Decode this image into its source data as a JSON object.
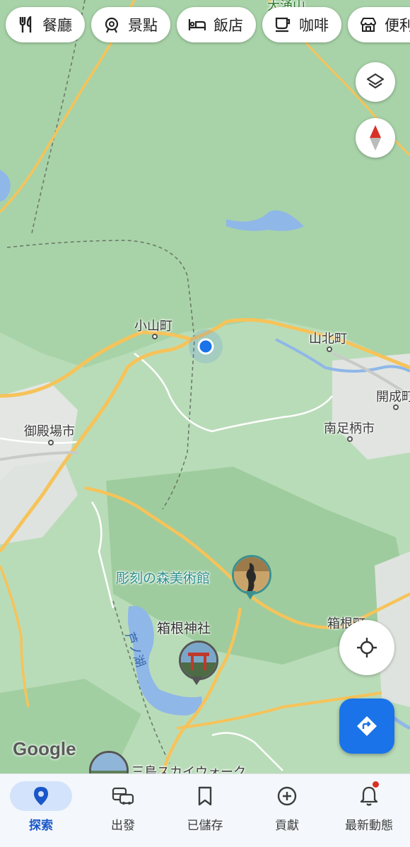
{
  "categories": [
    {
      "label": "餐廳",
      "icon": "fork-knife-icon"
    },
    {
      "label": "景點",
      "icon": "attraction-icon"
    },
    {
      "label": "飯店",
      "icon": "bed-icon"
    },
    {
      "label": "咖啡",
      "icon": "coffee-cup-icon"
    },
    {
      "label": "便利",
      "icon": "store-icon"
    }
  ],
  "map": {
    "places": [
      "小山町",
      "山北町",
      "御殿場市",
      "南足柄市",
      "開成町",
      "箱根町",
      "大涌山"
    ],
    "pois": [
      "彫刻の森美術館",
      "箱根神社",
      "三島スカイウォーク"
    ],
    "lake_label": "芦ノ湖",
    "google_logo": "Google",
    "colors": {
      "land": "#b9dcb8",
      "road": "#f6c35a",
      "water": "#8fb7e8",
      "accent": "#1a73e8",
      "poi": "#2e8f8f"
    }
  },
  "controls": {
    "layers": "layers-icon",
    "compass": "compass-icon",
    "locate": "my-location-icon",
    "directions": "directions-icon"
  },
  "bottom_nav": [
    {
      "label": "探索",
      "icon": "location-pin-icon",
      "active": true
    },
    {
      "label": "出發",
      "icon": "commute-icon",
      "active": false
    },
    {
      "label": "已儲存",
      "icon": "bookmark-icon",
      "active": false
    },
    {
      "label": "貢獻",
      "icon": "add-circle-icon",
      "active": false
    },
    {
      "label": "最新動態",
      "icon": "bell-icon",
      "active": false,
      "badge": true
    }
  ]
}
